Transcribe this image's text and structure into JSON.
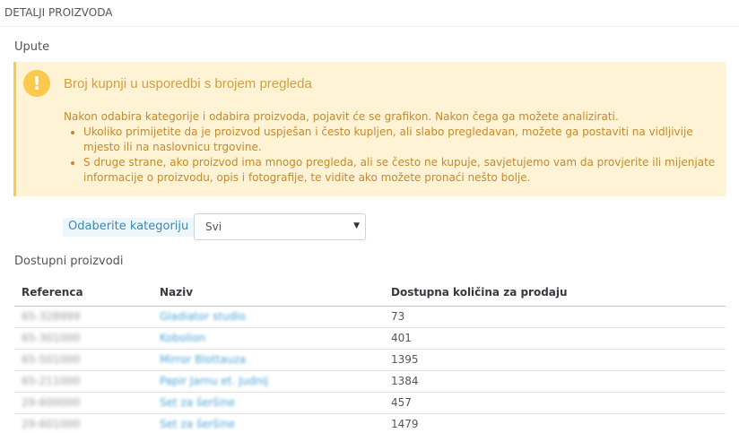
{
  "panel": {
    "heading": "DETALJI PROIZVODA"
  },
  "instructions": {
    "section_title": "Upute",
    "alert_title": "Broj kupnji u usporedbi s brojem pregleda",
    "intro": "Nakon odabira kategorije i odabira proizvoda, pojavit će se grafikon. Nakon čega ga možete analizirati.",
    "bullets": [
      "Ukoliko primijetite da je proizvod uspješan i često kupljen, ali slabo pregledavan, možete ga postaviti na vidljivije mjesto ili na naslovnicu trgovine.",
      "S druge strane, ako proizvod ima mnogo pregleda, ali se često ne kupuje, savjetujemo vam da provjerite ili mijenjate informacije o proizvodu, opis i fotografije, te vidite ako možete pronaći nešto bolje."
    ],
    "icon": "warning-icon",
    "colors": {
      "alert_bg": "#fff3d6",
      "alert_accent": "#fcc94f"
    }
  },
  "category": {
    "label": "Odaberite kategoriju",
    "selected": "Svi"
  },
  "products": {
    "section_title": "Dostupni proizvodi",
    "columns": [
      "Referenca",
      "Naziv",
      "Dostupna količina za prodaju"
    ],
    "rows": [
      {
        "ref": "65-328999",
        "name": "Gladiator studio",
        "qty": "73"
      },
      {
        "ref": "65-301000",
        "name": "Kobolion",
        "qty": "401"
      },
      {
        "ref": "65-501000",
        "name": "Mirror Blottauza",
        "qty": "1395"
      },
      {
        "ref": "65-211000",
        "name": "Papir Jarnu et. Judnij",
        "qty": "1384"
      },
      {
        "ref": "29-600000",
        "name": "Set za šeršine",
        "qty": "457"
      },
      {
        "ref": "29-601000",
        "name": "Set za šeršine",
        "qty": "1479"
      }
    ]
  }
}
